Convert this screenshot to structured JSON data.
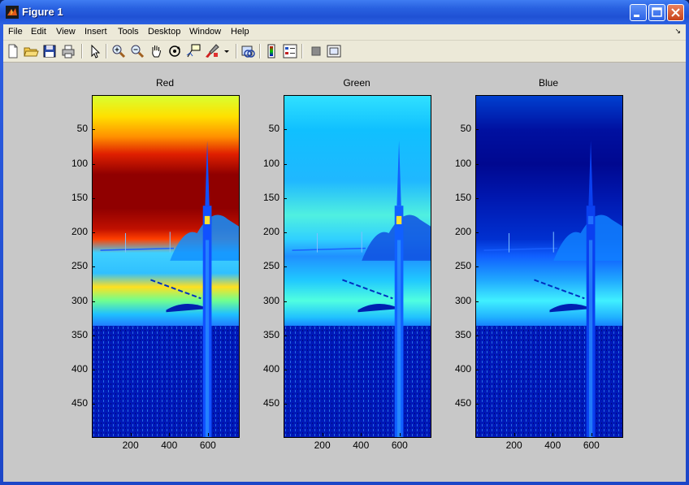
{
  "window": {
    "title": "Figure 1"
  },
  "menu": [
    "File",
    "Edit",
    "View",
    "Insert",
    "Tools",
    "Desktop",
    "Window",
    "Help"
  ],
  "toolbar": [
    {
      "name": "new-figure-icon"
    },
    {
      "name": "open-file-icon"
    },
    {
      "name": "save-icon"
    },
    {
      "name": "print-icon"
    },
    {
      "name": "arrow-select-icon"
    },
    {
      "name": "zoom-in-icon"
    },
    {
      "name": "zoom-out-icon"
    },
    {
      "name": "pan-hand-icon"
    },
    {
      "name": "rotate-3d-icon"
    },
    {
      "name": "data-cursor-icon"
    },
    {
      "name": "brush-icon"
    },
    {
      "name": "brush-dropdown-icon"
    },
    {
      "name": "link-plot-icon"
    },
    {
      "name": "colorbar-icon"
    },
    {
      "name": "legend-icon"
    },
    {
      "name": "hide-plot-tools-icon"
    },
    {
      "name": "show-plot-tools-icon"
    }
  ],
  "colors": {
    "titlebar": "#2860e0",
    "panel": "#c8c8c8",
    "chrome": "#ece9d8"
  },
  "axes": [
    {
      "title": "Red",
      "channel": "red",
      "yticks": [
        "50",
        "100",
        "150",
        "200",
        "250",
        "300",
        "350",
        "400",
        "450"
      ],
      "xticks": [
        "200",
        "400",
        "600"
      ]
    },
    {
      "title": "Green",
      "channel": "green",
      "yticks": [
        "50",
        "100",
        "150",
        "200",
        "250",
        "300",
        "350",
        "400",
        "450"
      ],
      "xticks": [
        "200",
        "400",
        "600"
      ]
    },
    {
      "title": "Blue",
      "channel": "blue",
      "yticks": [
        "50",
        "100",
        "150",
        "200",
        "250",
        "300",
        "350",
        "400",
        "450"
      ],
      "xticks": [
        "200",
        "400",
        "600"
      ]
    }
  ]
}
